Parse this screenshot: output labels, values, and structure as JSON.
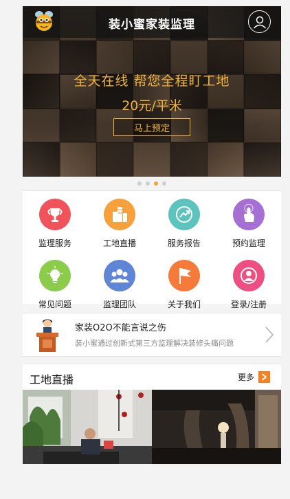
{
  "header": {
    "title": "装小蜜家装监理",
    "logo_icon": "bee-logo-icon",
    "user_icon": "user-icon"
  },
  "banner": {
    "slogan": "全天在线 帮您全程盯工地",
    "price": "20元/平米",
    "cta_label": "马上预定",
    "accent": "#f2b43c",
    "slide_count": 4,
    "active_slide": 3
  },
  "menu": [
    {
      "label": "监理服务",
      "icon": "trophy-icon",
      "color": "#f0545a"
    },
    {
      "label": "工地直播",
      "icon": "buildings-icon",
      "color": "#f7a13c"
    },
    {
      "label": "服务报告",
      "icon": "report-icon",
      "color": "#5cc3bd"
    },
    {
      "label": "预约监理",
      "icon": "tap-icon",
      "color": "#a56fd3"
    },
    {
      "label": "常见问题",
      "icon": "lightbulb-icon",
      "color": "#8ccc4b"
    },
    {
      "label": "监理团队",
      "icon": "team-icon",
      "color": "#5f86d6"
    },
    {
      "label": "关于我们",
      "icon": "flag-icon",
      "color": "#f67a3a"
    },
    {
      "label": "登录/注册",
      "icon": "profile-icon",
      "color": "#ee4f82"
    }
  ],
  "news": {
    "title": "家装O2O不能言说之伤",
    "subtitle": "装小蜜通过创新式第三方监理解决装修头痛问题",
    "icon": "speaker-icon"
  },
  "live": {
    "title": "工地直播",
    "more_label": "更多",
    "accent": "#f58220"
  }
}
